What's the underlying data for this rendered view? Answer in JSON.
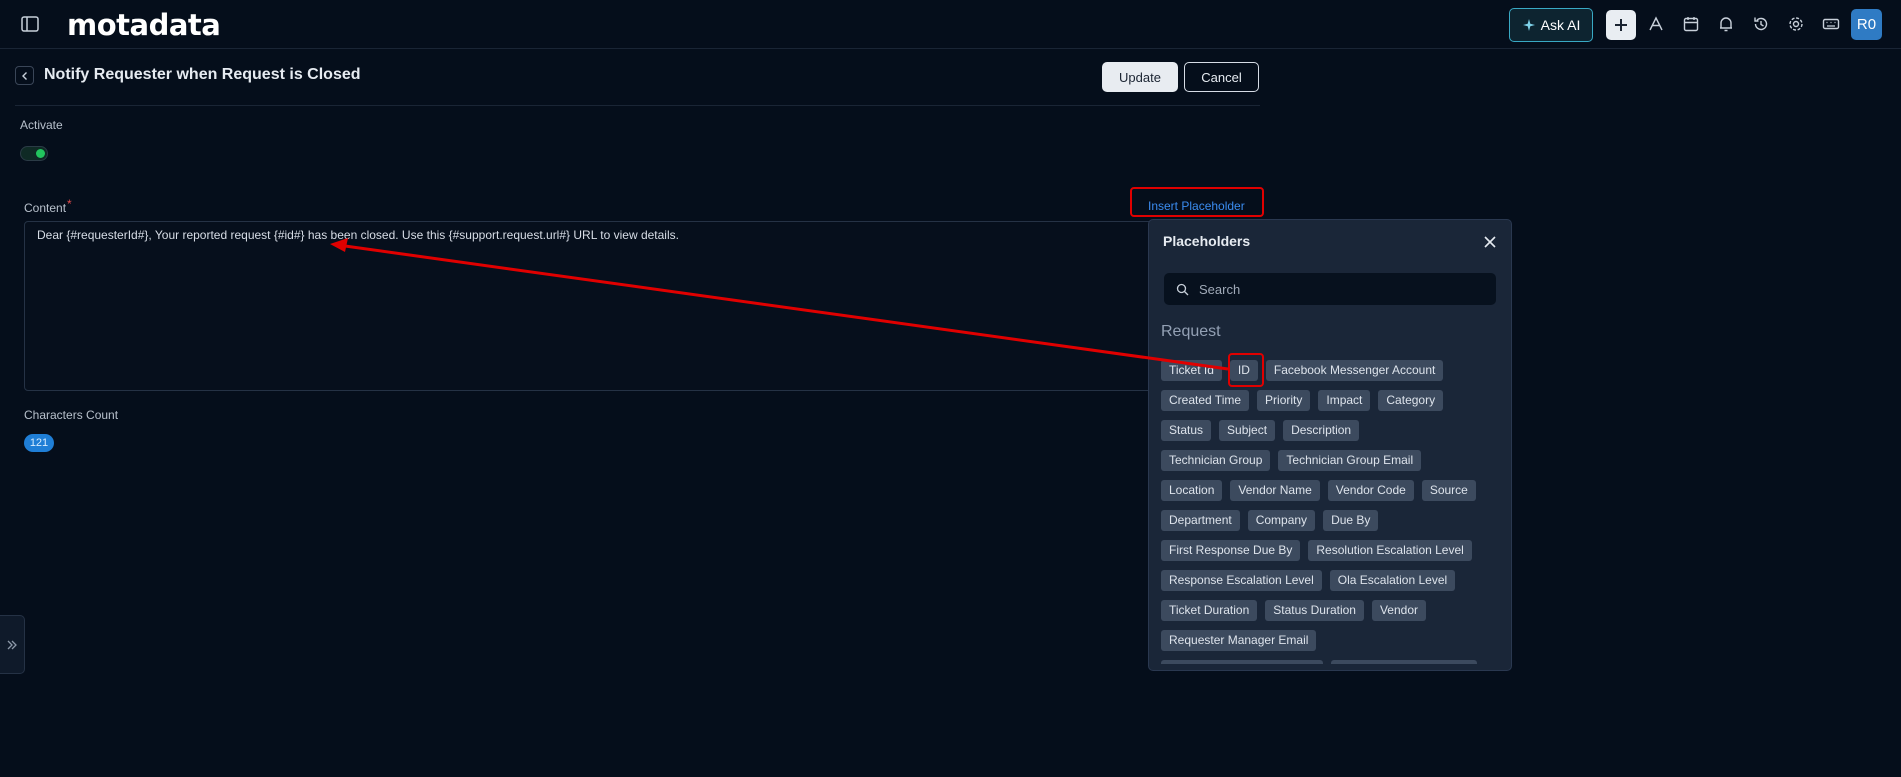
{
  "topbar": {
    "logo": "motadata",
    "ask_ai": "Ask AI",
    "avatar": "R0"
  },
  "header": {
    "title": "Notify Requester when Request is Closed",
    "update": "Update",
    "cancel": "Cancel"
  },
  "form": {
    "activate_label": "Activate",
    "activate_on": true,
    "content_label": "Content",
    "required_mark": "*",
    "insert_placeholder": "Insert Placeholder",
    "content_text": "Dear {#requesterId#}, Your reported request {#id#} has been closed. Use this {#support.request.url#} URL to view details.",
    "chars_label": "Characters Count",
    "chars_count": "121"
  },
  "placeholders": {
    "title": "Placeholders",
    "search_placeholder": "Search",
    "section": "Request",
    "rows": [
      [
        "Ticket Id",
        "ID",
        "Facebook Messenger Account"
      ],
      [
        "Created Time",
        "Priority",
        "Impact",
        "Category"
      ],
      [
        "Status",
        "Subject",
        "Description"
      ],
      [
        "Technician Group",
        "Technician Group Email"
      ],
      [
        "Location",
        "Vendor Name",
        "Vendor Code",
        "Source"
      ],
      [
        "Department",
        "Company",
        "Due By"
      ],
      [
        "First Response Due By",
        "Resolution Escalation Level"
      ],
      [
        "Response Escalation Level",
        "Ola Escalation Level"
      ],
      [
        "Ticket Duration",
        "Status Duration",
        "Vendor"
      ],
      [
        "Requester Manager Email"
      ]
    ]
  },
  "colors": {
    "accent": "#3b8cf0",
    "annotation": "#e00000",
    "toggle_on": "#22c55e"
  }
}
